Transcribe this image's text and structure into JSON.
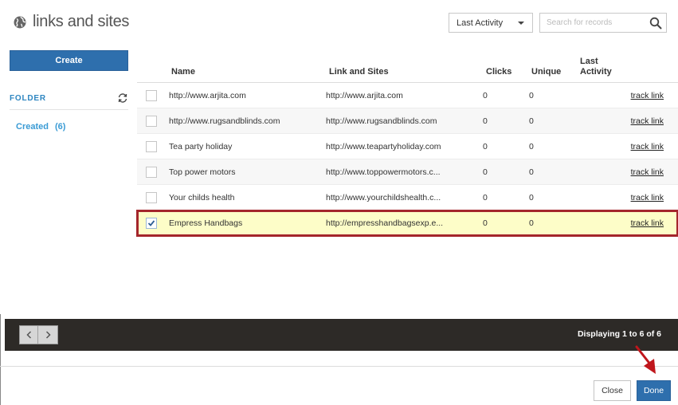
{
  "header": {
    "title": "links and sites",
    "sort_value": "Last Activity",
    "search_placeholder": "Search for records"
  },
  "sidebar": {
    "create_label": "Create",
    "folder_label": "FOLDER",
    "folders": [
      {
        "name": "Created",
        "count": "(6)"
      }
    ]
  },
  "table": {
    "columns": {
      "name": "Name",
      "link": "Link and Sites",
      "clicks": "Clicks",
      "unique": "Unique",
      "last_activity": "Last Activity"
    },
    "rows": [
      {
        "name": "http://www.arjita.com",
        "link": "http://www.arjita.com",
        "clicks": "0",
        "unique": "0",
        "action": "track link",
        "checked": false
      },
      {
        "name": "http://www.rugsandblinds.com",
        "link": "http://www.rugsandblinds.com",
        "clicks": "0",
        "unique": "0",
        "action": "track link",
        "checked": false
      },
      {
        "name": "Tea party holiday",
        "link": "http://www.teapartyholiday.com",
        "clicks": "0",
        "unique": "0",
        "action": "track link",
        "checked": false
      },
      {
        "name": "Top power motors",
        "link": "http://www.toppowermotors.c...",
        "clicks": "0",
        "unique": "0",
        "action": "track link",
        "checked": false
      },
      {
        "name": "Your childs health",
        "link": "http://www.yourchildshealth.c...",
        "clicks": "0",
        "unique": "0",
        "action": "track link",
        "checked": false
      },
      {
        "name": "Empress Handbags",
        "link": "http://empresshandbagsexp.e...",
        "clicks": "0",
        "unique": "0",
        "action": "track link",
        "checked": true
      }
    ]
  },
  "footer": {
    "displaying": "Displaying 1 to 6 of 6",
    "close_label": "Close",
    "done_label": "Done"
  },
  "colors": {
    "primary_button": "#2e6fad",
    "folder_accent": "#2e86c1",
    "selected_row_bg": "#fdfdc8",
    "selected_row_border": "#a4262c",
    "footer_bar": "#2d2a27",
    "annotation_arrow": "#c0161c"
  },
  "icons": {
    "header": "globe-icon",
    "search": "search-icon",
    "folder_refresh": "refresh-icon",
    "pager_prev": "chevron-left-icon",
    "pager_next": "chevron-right-icon",
    "checkbox": "checkmark-icon"
  }
}
